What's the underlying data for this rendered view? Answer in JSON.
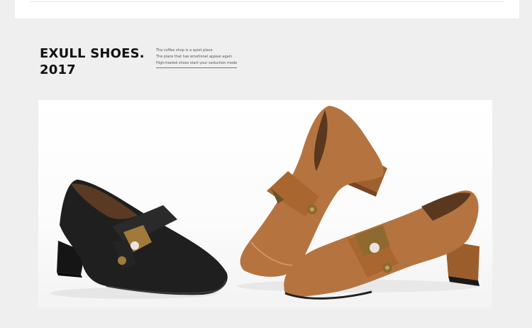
{
  "brand": {
    "line1": "EXULL SHOES.",
    "line2": "2017"
  },
  "taglines": [
    "The coffee shop is a quiet place",
    "The place that has emotional appeal again",
    "High-heeled shoes start your seduction mode"
  ],
  "photo": {
    "subject": "three loafer pumps with bee brooch",
    "colors": {
      "black_leather": "#1c1c1c",
      "tan_leather": "#b5743f",
      "brooch_gold": "#a07a3a",
      "pearl": "#e9e4dc"
    }
  }
}
